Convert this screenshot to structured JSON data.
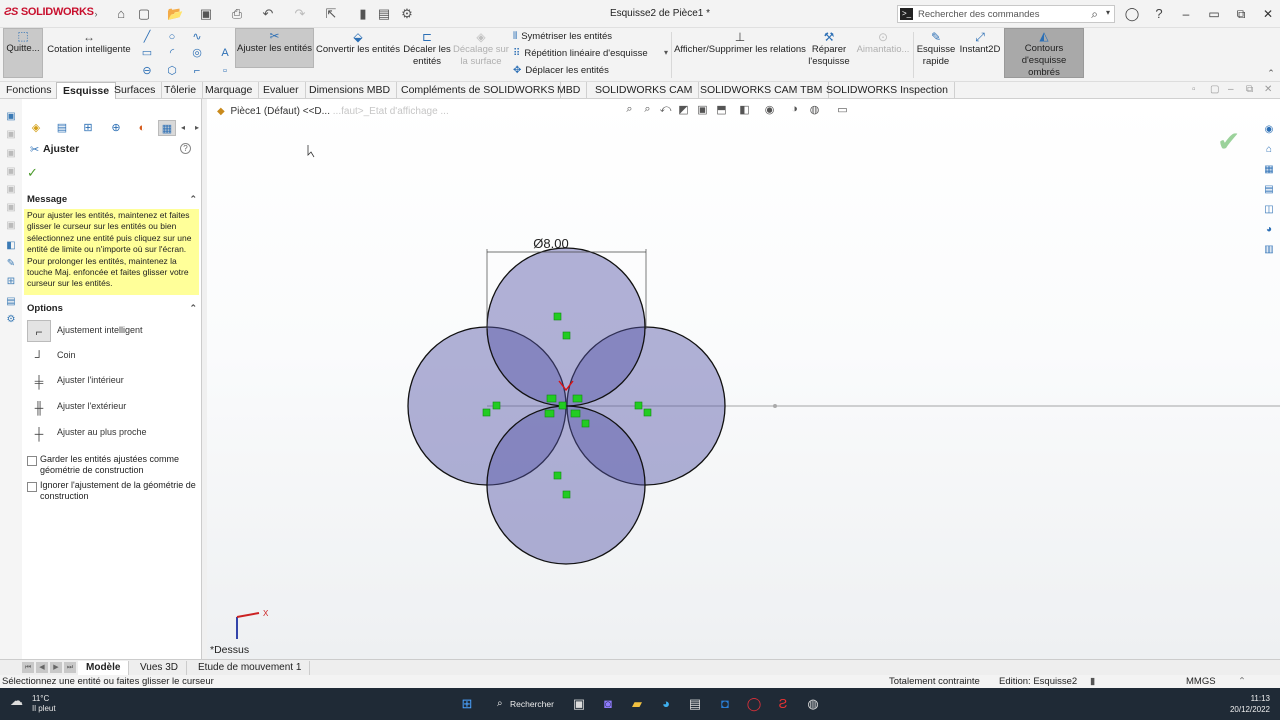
{
  "app": {
    "brand": "SOLIDWORKS",
    "doc_title": "Esquisse2 de Pièce1 *",
    "search_placeholder": "Rechercher des commandes"
  },
  "ribbon": {
    "exit_sketch": "Quitte...",
    "smart_dimension": "Cotation intelligente",
    "trim": "Ajuster les entités",
    "convert": "Convertir les entités",
    "offset_1": "Décaler les",
    "offset_2": "entités",
    "offset_surface_1": "Décalage sur",
    "offset_surface_2": "la surface",
    "mirror": "Symétriser les entités",
    "linear_pattern": "Répétition linéaire d'esquisse",
    "move": "Déplacer les entités",
    "relations": "Afficher/Supprimer les relations",
    "repair_1": "Réparer",
    "repair_2": "l'esquisse",
    "snaps": "Aimantatio...",
    "quick_1": "Esquisse",
    "quick_2": "rapide",
    "instant2d": "Instant2D",
    "shaded_1": "Contours",
    "shaded_2": "d'esquisse ombrés"
  },
  "tabs": [
    "Fonctions",
    "Esquisse",
    "Surfaces",
    "Tôlerie",
    "Marquage",
    "Evaluer",
    "Dimensions MBD",
    "Compléments de SOLIDWORKS",
    "MBD",
    "SOLIDWORKS CAM",
    "SOLIDWORKS CAM TBM",
    "SOLIDWORKS Inspection"
  ],
  "property_manager": {
    "title": "Ajuster",
    "message_header": "Message",
    "message": "Pour ajuster les entités, maintenez et faites glisser le curseur sur les entités ou bien sélectionnez une entité puis cliquez sur une entité de limite ou n'importe où sur l'écran. Pour prolonger les entités, maintenez la touche Maj. enfoncée et faites glisser votre curseur sur les entités.",
    "options_header": "Options",
    "options": [
      "Ajustement intelligent",
      "Coin",
      "Ajuster l'intérieur",
      "Ajuster l'extérieur",
      "Ajuster au plus proche"
    ],
    "keep_construction": "Garder les entités ajustées comme géométrie de construction",
    "ignore_construction": "Ignorer l'ajustement de la géométrie de construction"
  },
  "viewport": {
    "tree_item": "Pièce1 (Défaut) <<D...",
    "tree_fade": "...faut>_Etat d'affichage ...",
    "dimension": "Ø8.00",
    "view_name": "*Dessus",
    "triad_x": "X"
  },
  "bottom_tabs": [
    "Modèle",
    "Vues 3D",
    "Etude de mouvement 1"
  ],
  "status": {
    "hint": "Sélectionnez une entité ou faites glisser le curseur",
    "constraint": "Totalement contrainte",
    "editing": "Edition: Esquisse2",
    "units": "MMGS"
  },
  "taskbar": {
    "temp": "11°C",
    "weather": "Il pleut",
    "search": "Rechercher",
    "time": "11:13",
    "date": "20/12/2022"
  }
}
